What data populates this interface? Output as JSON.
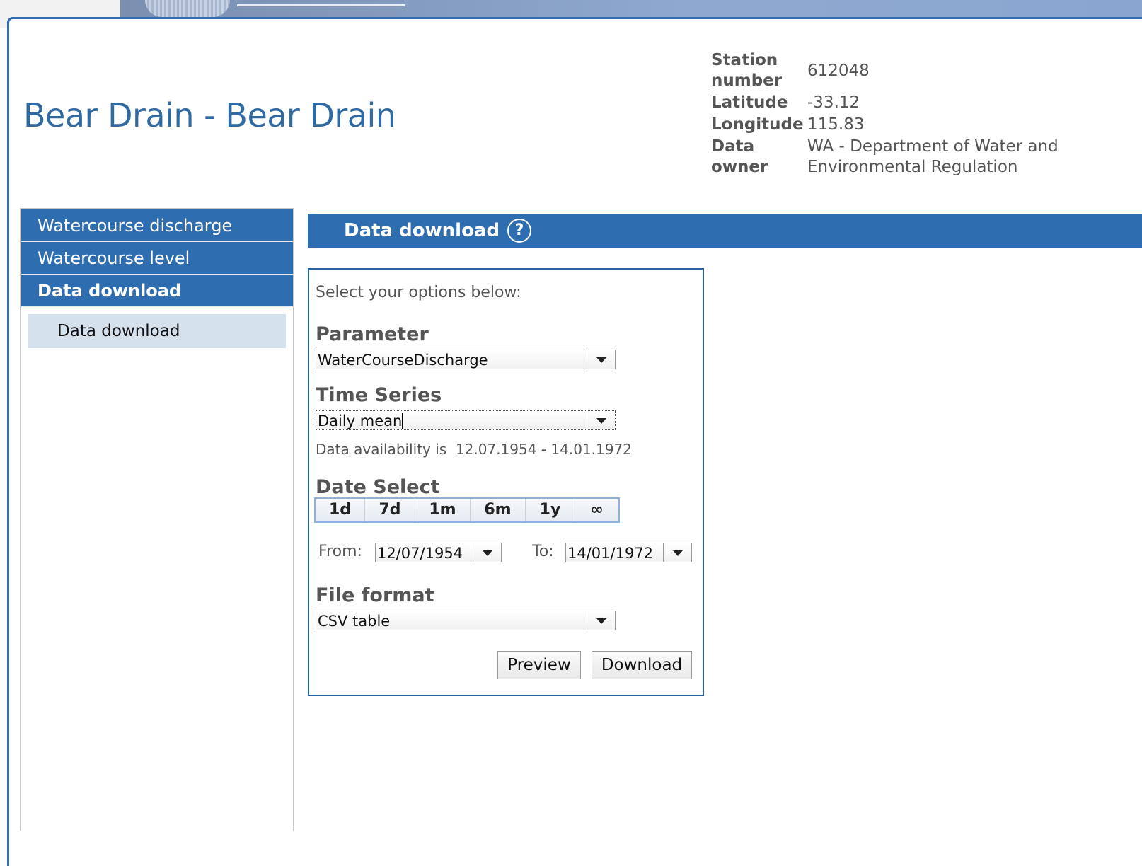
{
  "station": {
    "title": "Bear Drain - Bear Drain",
    "meta": [
      {
        "key": "Station\nnumber",
        "key_l1": "Station",
        "key_l2": "number",
        "value": "612048"
      },
      {
        "key_l1": "Latitude",
        "value": "-33.12"
      },
      {
        "key_l1": "Longitude",
        "value": "115.83"
      },
      {
        "key_l1": "Data",
        "key_l2": "owner",
        "value_l1": "WA - Department of Water and",
        "value_l2": "Environmental Regulation"
      }
    ]
  },
  "sidebar": {
    "items": [
      {
        "label": "Watercourse discharge"
      },
      {
        "label": "Watercourse level"
      },
      {
        "label": "Data download"
      }
    ],
    "sub_item": "Data download"
  },
  "panel": {
    "title": "Data download",
    "help_glyph": "?"
  },
  "form": {
    "intro": "Select your options below:",
    "parameter_label": "Parameter",
    "parameter_value": "WaterCourseDischarge",
    "timeseries_label": "Time Series",
    "timeseries_value": "Daily mean",
    "availability_prefix": "Data availability is",
    "availability_range": "12.07.1954 - 14.01.1972",
    "date_select_label": "Date Select",
    "ranges": [
      "1d",
      "7d",
      "1m",
      "6m",
      "1y",
      "∞"
    ],
    "from_label": "From:",
    "from_value": "12/07/1954",
    "to_label": "To:",
    "to_value": "14/01/1972",
    "fileformat_label": "File format",
    "fileformat_value": "CSV table",
    "preview_label": "Preview",
    "download_label": "Download"
  },
  "colors": {
    "accent": "#2e6db0",
    "title": "#2f6aa3",
    "sub_item_bg": "#d6e1ee"
  }
}
